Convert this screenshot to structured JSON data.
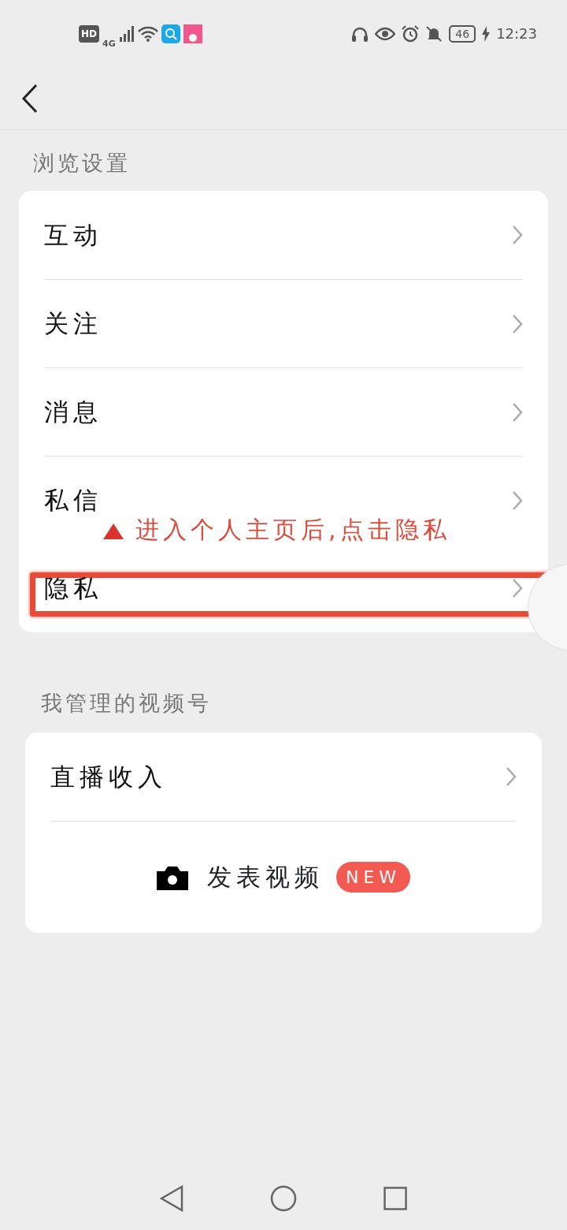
{
  "status_bar": {
    "hd": "HD",
    "network": "4G",
    "battery": "46",
    "time": "12:23"
  },
  "sections": [
    {
      "title": "浏览设置",
      "items": [
        {
          "label": "互动",
          "highlighted": false
        },
        {
          "label": "关注",
          "highlighted": false
        },
        {
          "label": "消息",
          "highlighted": false
        },
        {
          "label": "私信",
          "highlighted": false
        },
        {
          "label": "隐私",
          "highlighted": true
        }
      ]
    },
    {
      "title": "我管理的视频号",
      "items": [
        {
          "label": "直播收入",
          "highlighted": false
        }
      ],
      "action": {
        "label": "发表视频",
        "badge": "NEW"
      }
    }
  ],
  "annotation": {
    "text": "进入个人主页后,点击隐私"
  }
}
